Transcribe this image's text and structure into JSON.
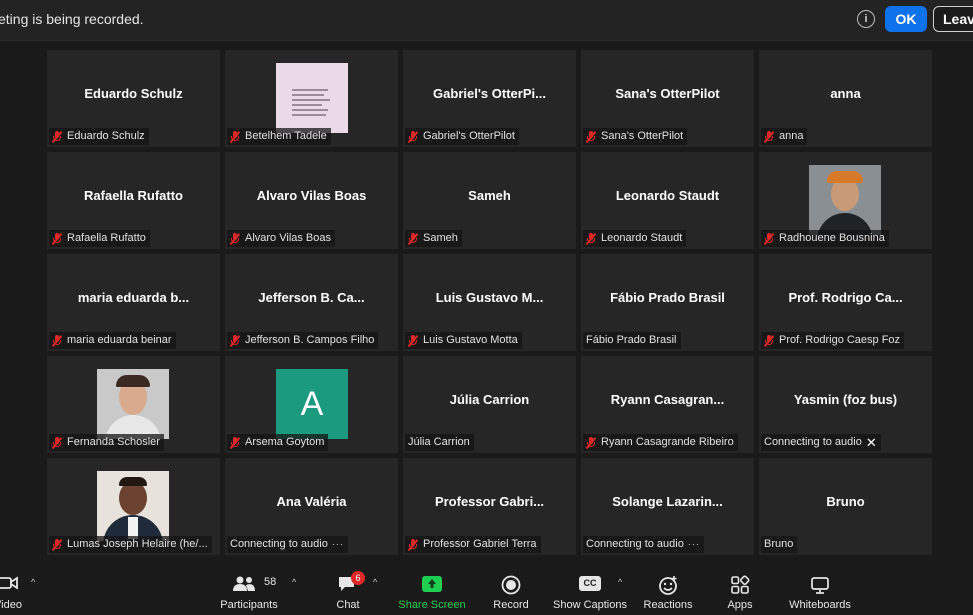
{
  "banner": {
    "message": "eting is being recorded.",
    "ok_label": "OK",
    "leave_label": "Leave",
    "info_glyph": "i"
  },
  "tiles": [
    {
      "center": "Eduardo Schulz",
      "label": "Eduardo Schulz",
      "muted": true
    },
    {
      "center": "",
      "label": "Betelhem Tadele",
      "muted": true,
      "avatar": "document"
    },
    {
      "center": "Gabriel's  OtterPi...",
      "label": "Gabriel's OtterPilot",
      "muted": true
    },
    {
      "center": "Sana's OtterPilot",
      "label": "Sana's OtterPilot",
      "muted": true
    },
    {
      "center": "anna",
      "label": "anna",
      "muted": true
    },
    {
      "center": "Rafaella Rufatto",
      "label": "Rafaella Rufatto",
      "muted": true
    },
    {
      "center": "Alvaro Vilas Boas",
      "label": "Alvaro Vilas Boas",
      "muted": true
    },
    {
      "center": "Sameh",
      "label": "Sameh",
      "muted": true
    },
    {
      "center": "Leonardo Staudt",
      "label": "Leonardo Staudt",
      "muted": true
    },
    {
      "center": "",
      "label": "Radhouene Bousnina",
      "muted": true,
      "avatar": "photo-man-cap"
    },
    {
      "center": "maria eduarda b...",
      "label": "maria eduarda beinar",
      "muted": true
    },
    {
      "center": "Jefferson B. Ca...",
      "label": "Jefferson B. Campos Filho",
      "muted": true
    },
    {
      "center": "Luis Gustavo M...",
      "label": "Luis Gustavo Motta",
      "muted": true
    },
    {
      "center": "Fábio Prado Brasil",
      "label": "Fábio Prado Brasil",
      "muted": false
    },
    {
      "center": "Prof.  Rodrigo  Ca...",
      "label": "Prof. Rodrigo Caesp Foz",
      "muted": true
    },
    {
      "center": "",
      "label": "Fernanda Schosler",
      "muted": true,
      "avatar": "photo-woman"
    },
    {
      "center": "",
      "label": "Arsema Goytom",
      "muted": true,
      "avatar": "letter",
      "letter": "A"
    },
    {
      "center": "Júlia Carrion",
      "label": "Júlia Carrion",
      "muted": false
    },
    {
      "center": "Ryann  Casagran...",
      "label": "Ryann Casagrande Ribeiro",
      "muted": true
    },
    {
      "center": "Yasmin (foz bus)",
      "label": "Connecting to audio",
      "muted": false,
      "suffix": "x"
    },
    {
      "center": "",
      "label": "Lumas Joseph Helaire (he/...",
      "muted": true,
      "avatar": "photo-man-suit"
    },
    {
      "center": "Ana Valéria",
      "label": "Connecting to audio",
      "muted": false,
      "suffix": "dots"
    },
    {
      "center": "Professor  Gabri...",
      "label": "Professor Gabriel Terra",
      "muted": true
    },
    {
      "center": "Solange  Lazarin...",
      "label": "Connecting to audio",
      "muted": false,
      "suffix": "dots"
    },
    {
      "center": "Bruno",
      "label": "Bruno",
      "muted": false
    }
  ],
  "toolbar": {
    "video": "Video",
    "participants": "Participants",
    "participants_count": "58",
    "chat": "Chat",
    "chat_badge": "6",
    "share": "Share Screen",
    "record": "Record",
    "captions": "Show Captions",
    "captions_icon_text": "CC",
    "reactions": "Reactions",
    "apps": "Apps",
    "whiteboards": "Whiteboards"
  },
  "colors": {
    "accent_blue": "#0e72ed",
    "share_green": "#1fcf52",
    "mute_red": "#e02828",
    "tile_bg": "#262626"
  }
}
